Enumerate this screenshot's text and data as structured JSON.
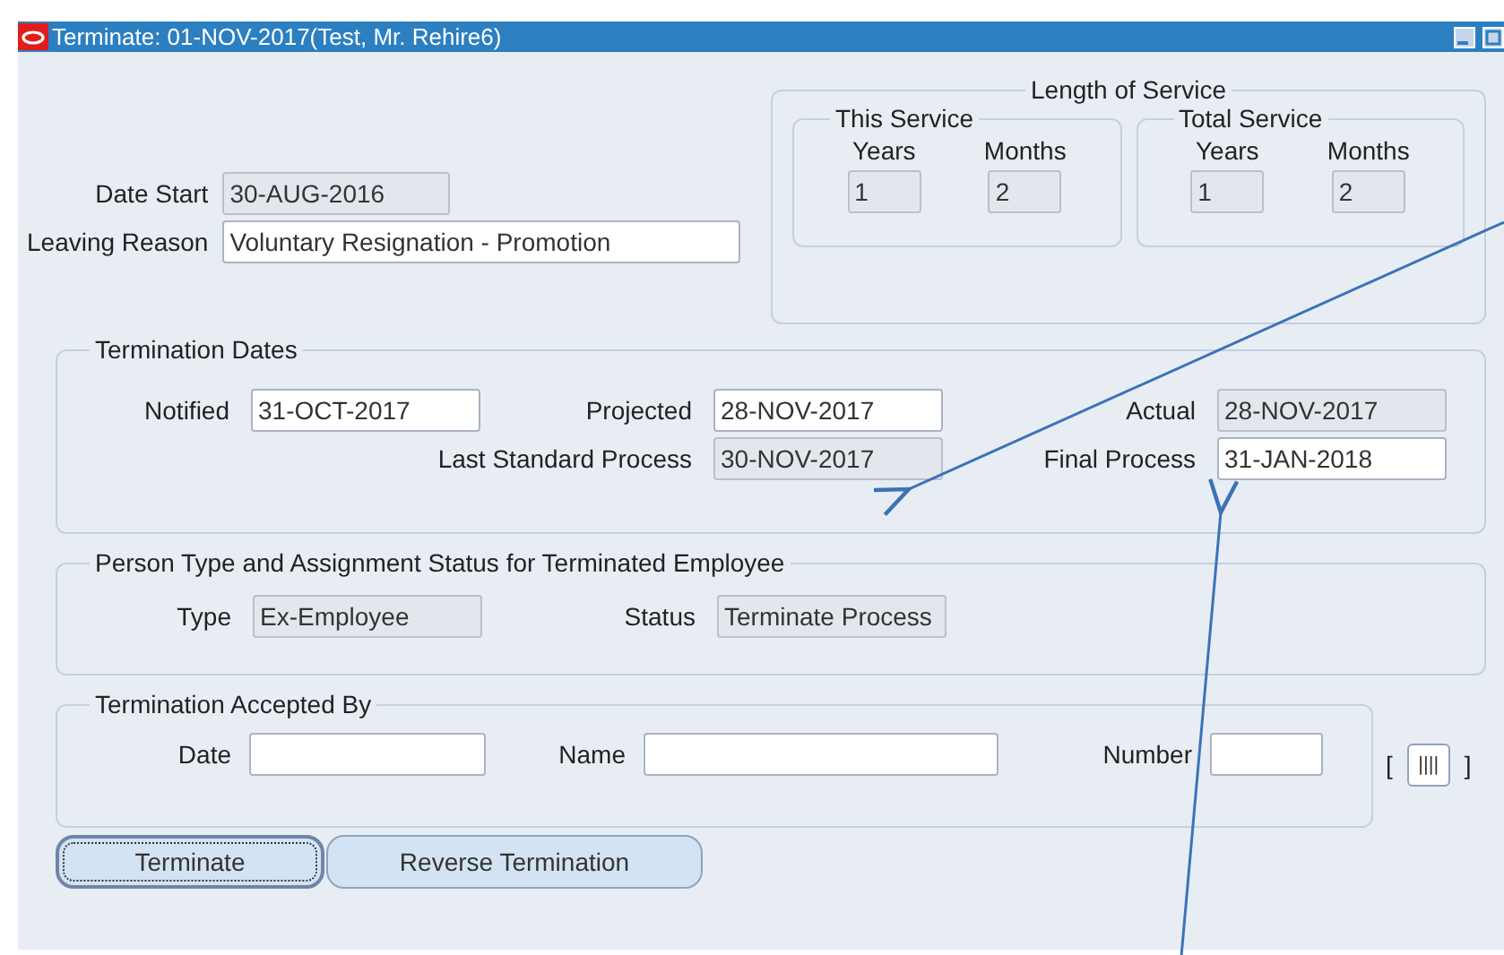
{
  "window": {
    "title": "Terminate: 01-NOV-2017(Test, Mr. Rehire6)"
  },
  "date_start": {
    "label": "Date Start",
    "value": "30-AUG-2016",
    "readonly": true
  },
  "leaving_reason": {
    "label": "Leaving Reason",
    "value": "Voluntary Resignation - Promotion",
    "readonly": false
  },
  "length_of_service": {
    "title": "Length of Service",
    "groups": [
      {
        "title": "This Service",
        "fields": [
          {
            "label": "Years",
            "value": "1",
            "readonly": true
          },
          {
            "label": "Months",
            "value": "2",
            "readonly": true
          }
        ]
      },
      {
        "title": "Total Service",
        "fields": [
          {
            "label": "Years",
            "value": "1",
            "readonly": true
          },
          {
            "label": "Months",
            "value": "2",
            "readonly": true
          }
        ]
      }
    ]
  },
  "termination_dates": {
    "title": "Termination Dates",
    "fields": [
      {
        "label": "Notified",
        "value": "31-OCT-2017",
        "readonly": false
      },
      {
        "label": "Projected",
        "value": "28-NOV-2017",
        "readonly": false
      },
      {
        "label": "Actual",
        "value": "28-NOV-2017",
        "readonly": true
      },
      {
        "label": "Last Standard Process",
        "value": "30-NOV-2017",
        "readonly": true
      },
      {
        "label": "Final Process",
        "value": "31-JAN-2018",
        "readonly": false
      }
    ]
  },
  "person_type": {
    "title": "Person Type and Assignment Status for Terminated Employee",
    "fields": [
      {
        "label": "Type",
        "value": "Ex-Employee",
        "readonly": true
      },
      {
        "label": "Status",
        "value": "Terminate Process",
        "readonly": true
      }
    ]
  },
  "accepted_by": {
    "title": "Termination Accepted By",
    "fields": [
      {
        "label": "Date",
        "readonly": false
      },
      {
        "label": "Name",
        "readonly": false
      },
      {
        "label": "Number",
        "readonly": false
      }
    ]
  },
  "descriptive_flex": {
    "open": "[",
    "label": "||||",
    "close": "]"
  },
  "buttons": [
    {
      "label": "Terminate",
      "focused": true
    },
    {
      "label": "Reverse Termination",
      "focused": false
    }
  ]
}
